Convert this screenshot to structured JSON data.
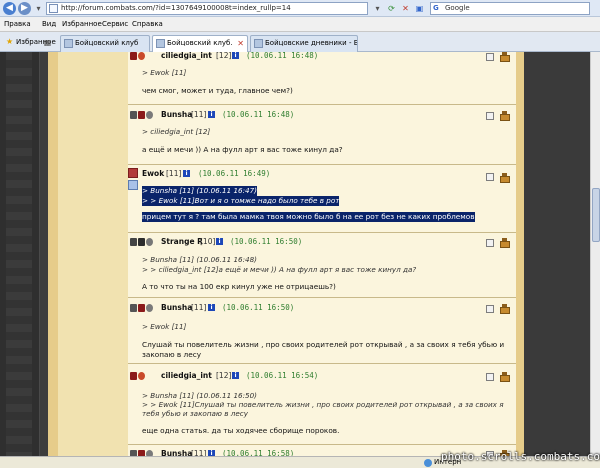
{
  "browser": {
    "url": "http://forum.combats.com/?id=1307649100008t=index_rullp=14",
    "search_placeholder": "Google",
    "menu": [
      "Правка",
      "Вид",
      "Избранное",
      "Сервис",
      "Справка"
    ],
    "favorites_label": "Избранное",
    "tabs": [
      {
        "label": "Бойцовский клуб",
        "active": false
      },
      {
        "label": "Бойцовский клуб.",
        "active": true
      },
      {
        "label": "Бойцовские дневники - Бу...",
        "active": false
      }
    ],
    "status_text": "Интерн",
    "watermark": "photo.scrolls.combats.com"
  },
  "posts": [
    {
      "author": "ciliedgia_int",
      "level": "[12]",
      "time": "(10.06.11 16:48)",
      "quote": [
        "> Ewok [11]"
      ],
      "body": [
        "чем смог, может и туда, главное чем?)"
      ]
    },
    {
      "author": "Bunsha",
      "level": "[11]",
      "time": "(10.06.11 16:48)",
      "quote": [
        "> ciliedgia_int [12]"
      ],
      "body": [
        "а ещё и мечи )) А на фулл арт я вас тоже кинул да?"
      ]
    },
    {
      "author": "Ewok",
      "level": "[11]",
      "time": "(10.06.11 16:49)",
      "quote": [
        "> Bunsha [11] (10.06.11 16:47)",
        "> > Ewok [11]Вот и я о томже надо было тебе в рот"
      ],
      "body": [
        "прицем тут я ? там была мамка твоя можно было б на ее рот без не каких проблемов"
      ]
    },
    {
      "author": "Strange R",
      "level": "[10]",
      "time": "(10.06.11 16:50)",
      "quote": [
        "> Bunsha [11] (10.06.11 16:48)",
        "> > ciliedgia_int [12]а ещё и мечи )) А на фулл арт я вас тоже кинул да?"
      ],
      "body": [
        "А то что ты на 100 екр кинул уже не отрицаешь?)"
      ]
    },
    {
      "author": "Bunsha",
      "level": "[11]",
      "time": "(10.06.11 16:50)",
      "quote": [
        "> Ewok [11]"
      ],
      "body": [
        "Слушай ты повелитель жизни , про своих родителей рот открывай , а за своих я тебя убью и",
        "закопаю в лесу"
      ]
    },
    {
      "author": "ciliedgia_int",
      "level": "[12]",
      "time": "(10.06.11 16:54)",
      "quote": [
        "> Bunsha [11] (10.06.11 16:50)",
        "> > Ewok [11]Слушай ты повелитель жизни , про своих родителей рот открывай , а за своих я",
        "тебя убью и закопаю в лесу"
      ],
      "body": [
        "еще одна статья. да ты ходячее сборище пороков."
      ]
    },
    {
      "author": "Bunsha",
      "level": "[11]",
      "time": "(10.06.11 16:58)",
      "quote": [],
      "body": []
    }
  ],
  "colors": {
    "parchment": "#f1e2b0",
    "post_bg": "#fbf5dd",
    "time_green": "#2e7d2e",
    "selection": "#0a246a"
  }
}
